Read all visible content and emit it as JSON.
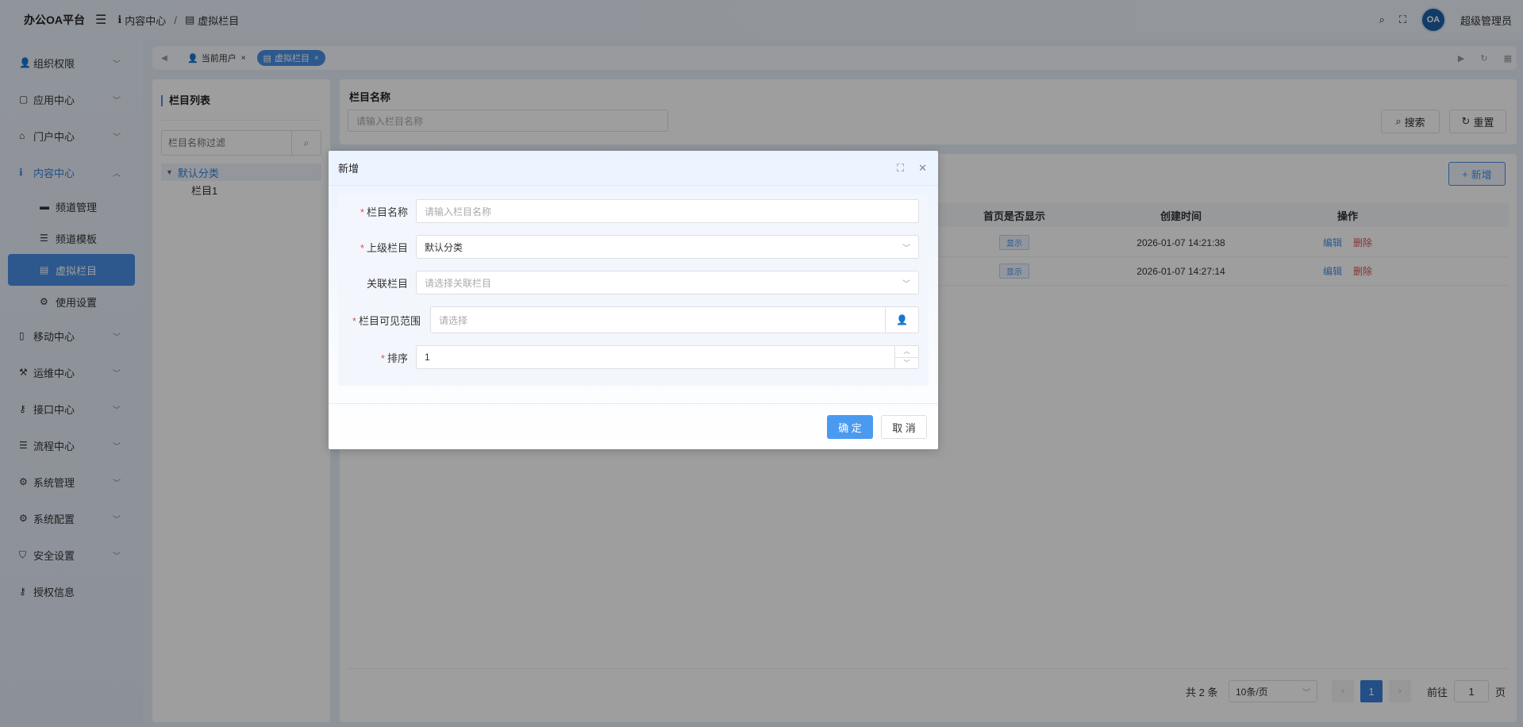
{
  "header": {
    "brand": "办公OA平台",
    "breadcrumb": [
      "内容中心",
      "虚拟栏目"
    ],
    "user_name": "超级管理员",
    "avatar_text": "OA"
  },
  "sidebar": {
    "items": [
      {
        "label": "组织权限",
        "icon": "user-icon"
      },
      {
        "label": "应用中心",
        "icon": "bag-icon"
      },
      {
        "label": "门户中心",
        "icon": "home-icon"
      },
      {
        "label": "内容中心",
        "icon": "info-icon"
      },
      {
        "label": "移动中心",
        "icon": "mobile-icon"
      },
      {
        "label": "运维中心",
        "icon": "hammer-icon"
      },
      {
        "label": "接口中心",
        "icon": "key-icon"
      },
      {
        "label": "流程中心",
        "icon": "list-icon"
      },
      {
        "label": "系统管理",
        "icon": "gear-icon"
      },
      {
        "label": "系统配置",
        "icon": "cog-icon"
      },
      {
        "label": "安全设置",
        "icon": "shield-icon"
      },
      {
        "label": "授权信息",
        "icon": "key-icon"
      }
    ],
    "subitems": [
      {
        "label": "频道管理"
      },
      {
        "label": "频道模板"
      },
      {
        "label": "虚拟栏目"
      },
      {
        "label": "使用设置"
      }
    ]
  },
  "tabs": [
    {
      "label": "当前用户"
    },
    {
      "label": "虚拟栏目"
    }
  ],
  "left_panel": {
    "title": "栏目列表",
    "filter_placeholder": "栏目名称过滤",
    "tree_root": "默认分类",
    "tree_child": "栏目1"
  },
  "search": {
    "label": "栏目名称",
    "placeholder": "请输入栏目名称",
    "search_btn": "搜索",
    "reset_btn": "重置"
  },
  "table": {
    "add_btn": "新增",
    "columns": [
      "首页是否显示",
      "创建时间",
      "操作"
    ],
    "rows": [
      {
        "show": "显示",
        "created": "2026-01-07 14:21:38",
        "edit": "编辑",
        "delete": "删除"
      },
      {
        "show": "显示",
        "created": "2026-01-07 14:27:14",
        "edit": "编辑",
        "delete": "删除"
      }
    ]
  },
  "pagination": {
    "total": "共 2 条",
    "page_size": "10条/页",
    "current_page": "1",
    "goto_label": "前往",
    "goto_value": "1",
    "page_suffix": "页"
  },
  "modal": {
    "title": "新增",
    "fields": [
      {
        "label": "栏目名称",
        "placeholder": "请输入栏目名称",
        "required": true
      },
      {
        "label": "上级栏目",
        "value": "默认分类",
        "required": true
      },
      {
        "label": "关联栏目",
        "placeholder": "请选择关联栏目",
        "required": false
      },
      {
        "label": "栏目可见范围",
        "placeholder": "请选择",
        "required": true
      },
      {
        "label": "排序",
        "value": "1",
        "required": true
      }
    ],
    "ok_btn": "确 定",
    "cancel_btn": "取 消"
  },
  "colors": {
    "accent": "#4a8ee6",
    "danger": "#e55050"
  }
}
